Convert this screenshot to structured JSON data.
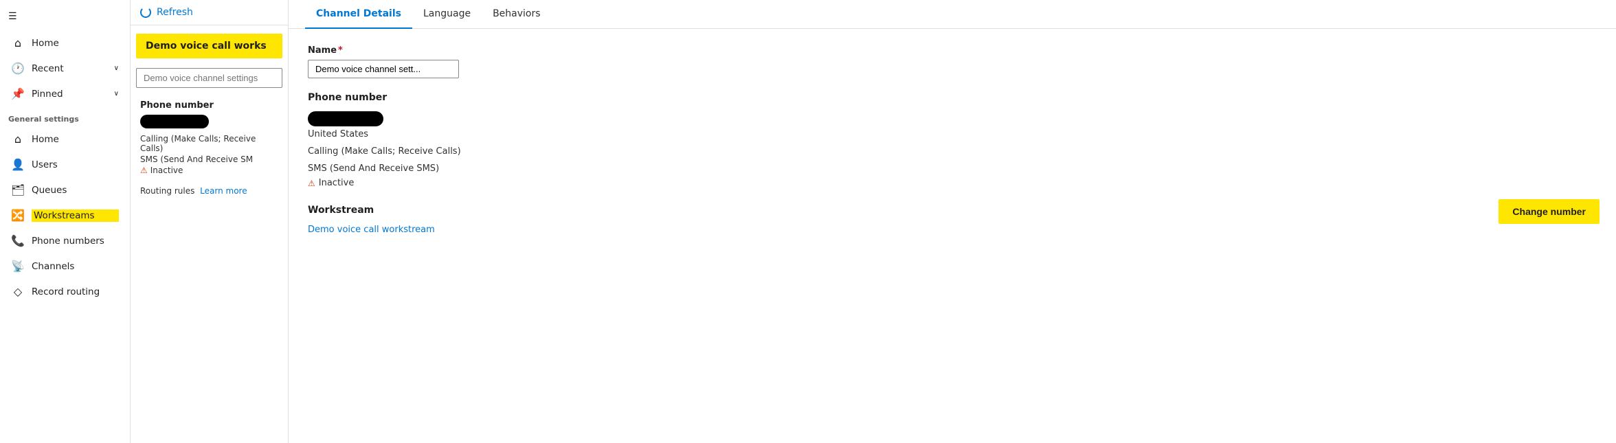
{
  "sidebar": {
    "hamburger_icon": "☰",
    "nav_items": [
      {
        "id": "home-top",
        "label": "Home",
        "icon": "⌂"
      },
      {
        "id": "recent",
        "label": "Recent",
        "icon": "🕐",
        "chevron": "∨"
      },
      {
        "id": "pinned",
        "label": "Pinned",
        "icon": "📌",
        "chevron": "∨"
      }
    ],
    "section_header": "General settings",
    "settings_items": [
      {
        "id": "home-settings",
        "label": "Home",
        "icon": "⌂"
      },
      {
        "id": "users",
        "label": "Users",
        "icon": "👤"
      },
      {
        "id": "queues",
        "label": "Queues",
        "icon": "🗂"
      },
      {
        "id": "workstreams",
        "label": "Workstreams",
        "icon": "🔀",
        "highlighted": true
      },
      {
        "id": "phone-numbers",
        "label": "Phone numbers",
        "icon": "📞"
      },
      {
        "id": "channels",
        "label": "Channels",
        "icon": "📡"
      },
      {
        "id": "record-routing",
        "label": "Record routing",
        "icon": "◇"
      }
    ]
  },
  "middle": {
    "refresh_label": "Refresh",
    "banner_text": "Demo voice call works",
    "channel_settings_placeholder": "Demo voice channel settings",
    "phone_section_label": "Phone number",
    "phone_meta": "Calling (Make Calls; Receive Calls)",
    "phone_sms": "SMS (Send And Receive SM",
    "inactive_label": "Inactive",
    "routing_prefix": "Routing rules",
    "routing_link": "Learn more"
  },
  "detail": {
    "tabs": [
      {
        "id": "channel-details",
        "label": "Channel Details",
        "active": true
      },
      {
        "id": "language",
        "label": "Language",
        "active": false
      },
      {
        "id": "behaviors",
        "label": "Behaviors",
        "active": false
      }
    ],
    "name_label": "Name",
    "name_required": "*",
    "name_value": "Demo voice channel sett...",
    "phone_section_label": "Phone number",
    "phone_country": "United States",
    "phone_calling": "Calling (Make Calls; Receive Calls)",
    "phone_sms": "SMS (Send And Receive SMS)",
    "inactive_label": "Inactive",
    "workstream_section_label": "Workstream",
    "workstream_link_text": "Demo voice call workstream",
    "change_number_btn": "Change number"
  }
}
